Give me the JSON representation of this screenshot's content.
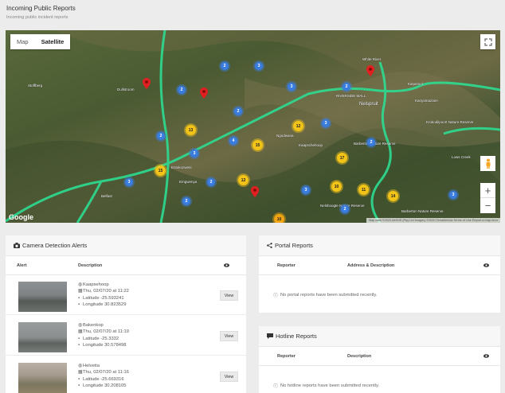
{
  "header": {
    "title": "Incoming Public Reports",
    "subtitle": "Incoming public incident reports"
  },
  "map": {
    "type_buttons": [
      "Map",
      "Satellite"
    ],
    "active_type": "Satellite",
    "zoom_in": "+",
    "zoom_out": "−",
    "google_logo": "Google",
    "attribution": "Map data ©2020 AfriGIS (Pty) Ltd Imagery ©2020 TerraMetrics  Terms of Use  Report a map error",
    "place_labels": [
      "White River",
      "RIVERSIDE MALL",
      "Nelspruit",
      "Kanyamazane",
      "Krokodilpoort Nature Reserve",
      "Ngodwana",
      "Kaapschehoop",
      "Barberton Nature Reserve",
      "Barberton Nature Reserve",
      "Nelshoogte Nature Reserve",
      "Lows Creek",
      "Emgwenya",
      "Belfast",
      "Dullstroom",
      "Stoffberg",
      "Entokozweni",
      "Kiepersol"
    ],
    "clusters": [
      {
        "count": "13",
        "color": "yellow"
      },
      {
        "count": "15",
        "color": "yellow"
      },
      {
        "count": "12",
        "color": "yellow"
      },
      {
        "count": "15",
        "color": "yellow"
      },
      {
        "count": "17",
        "color": "yellow"
      },
      {
        "count": "12",
        "color": "yellow"
      },
      {
        "count": "10",
        "color": "yellow"
      },
      {
        "count": "11",
        "color": "yellow"
      },
      {
        "count": "14",
        "color": "yellow"
      },
      {
        "count": "10",
        "color": "orange"
      },
      {
        "count": "2",
        "color": "blue"
      },
      {
        "count": "3",
        "color": "blue"
      },
      {
        "count": "2",
        "color": "blue"
      },
      {
        "count": "3",
        "color": "blue"
      },
      {
        "count": "2",
        "color": "blue"
      },
      {
        "count": "2",
        "color": "blue"
      },
      {
        "count": "3",
        "color": "blue"
      },
      {
        "count": "2",
        "color": "blue"
      },
      {
        "count": "4",
        "color": "blue"
      },
      {
        "count": "3",
        "color": "blue"
      },
      {
        "count": "2",
        "color": "blue"
      },
      {
        "count": "3",
        "color": "blue"
      },
      {
        "count": "2",
        "color": "blue"
      },
      {
        "count": "3",
        "color": "blue"
      },
      {
        "count": "2",
        "color": "blue"
      },
      {
        "count": "3",
        "color": "blue"
      },
      {
        "count": "2",
        "color": "blue"
      }
    ]
  },
  "camera_alerts": {
    "title": "Camera Detection Alerts",
    "columns": {
      "alert": "Alert",
      "description": "Description"
    },
    "rows": [
      {
        "location": "Kaapsehoop",
        "datetime": "Thu, 02/07/20 at 11:22",
        "latitude": "Latitude -25.593241",
        "longitude": "Longitude 30.823529",
        "action": "View"
      },
      {
        "location": "Bakenkop",
        "datetime": "Thu, 02/07/20 at 11:19",
        "latitude": "Latitude -25.3332",
        "longitude": "Longitude 30.578498",
        "action": "View"
      },
      {
        "location": "Helvetia",
        "datetime": "Thu, 02/07/20 at 11:16",
        "latitude": "Latitude -25.669316",
        "longitude": "Longitude 30.208105",
        "action": "View"
      }
    ]
  },
  "portal_reports": {
    "title": "Portal Reports",
    "columns": {
      "reporter": "Reporter",
      "address": "Address & Description"
    },
    "empty": "No portal reports have been submitted recently."
  },
  "hotline_reports": {
    "title": "Hotline Reports",
    "columns": {
      "reporter": "Reporter",
      "description": "Description"
    },
    "empty": "No hotline reports have been submitted recently."
  }
}
